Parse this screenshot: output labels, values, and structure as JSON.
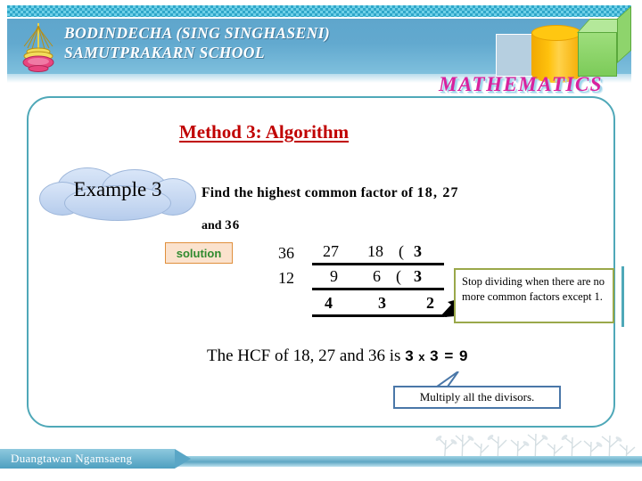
{
  "header": {
    "school_name": "BODINDECHA (SING SINGHASENI)\nSAMUTPRAKARN SCHOOL",
    "subject_word": "MATHEMATICS",
    "logo_alt": "school-emblem",
    "accent_blue": "#5fa6cc",
    "accent_teal": "#4fa8b8",
    "math_pink": "#d9219e"
  },
  "slide": {
    "title": "Method 3: Algorithm",
    "title_color": "#c00000",
    "example_label": "Example 3",
    "question_line1_a": "Find the highest  common factor of ",
    "question_line1_b": "18, 27",
    "question_line2_a": "and  ",
    "question_line2_b": "36",
    "solution_label": "solution"
  },
  "division": {
    "rows": [
      {
        "outside": "36",
        "c1": "27",
        "c2": "18",
        "c3": "(",
        "quotient": "3"
      },
      {
        "outside": "12",
        "c1": "9",
        "c2": "6",
        "c3": "(",
        "quotient": "3"
      }
    ],
    "result_row": {
      "c1": "4",
      "c2": "3",
      "c3": "2"
    }
  },
  "notes": {
    "stop_note": "Stop dividing when there are no more common factors except 1.",
    "stop_note_border": "#9aa84a",
    "multiply_note": "Multiply all the divisors.",
    "multiply_note_border": "#4a77a8"
  },
  "conclusion": {
    "text": "The HCF of 18, 27 and 36 is ",
    "answer_a": "3",
    "answer_x": " x ",
    "answer_b": "3",
    "answer_eq": " = ",
    "answer_result": "9"
  },
  "footer": {
    "author": "Duangtawan  Ngamsaeng"
  }
}
